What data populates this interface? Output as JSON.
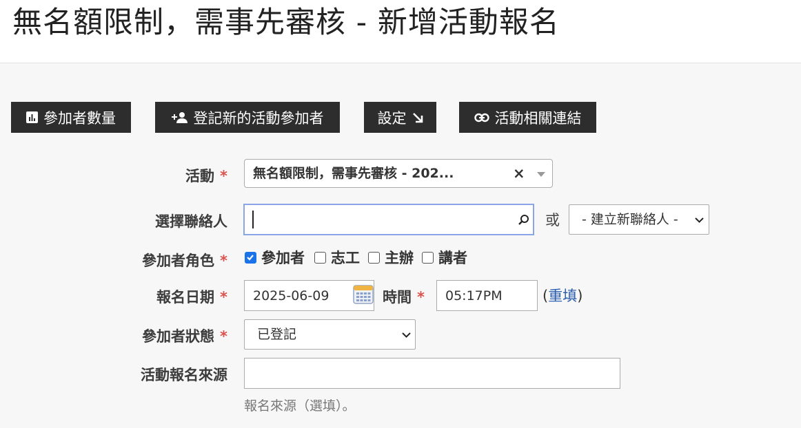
{
  "page": {
    "title": "無名額限制，需事先審核 - 新增活動報名"
  },
  "toolbar": {
    "participants_count": "參加者數量",
    "register_new": "登記新的活動參加者",
    "settings": "設定",
    "event_links": "活動相關連結"
  },
  "form": {
    "event": {
      "label": "活動",
      "value": "無名額限制，需事先審核 - 202..."
    },
    "contact": {
      "label": "選擇聯絡人",
      "value": "",
      "or": "或",
      "new_contact": "- 建立新聯絡人 -"
    },
    "role": {
      "label": "參加者角色",
      "options": [
        {
          "label": "參加者",
          "checked": true
        },
        {
          "label": "志工",
          "checked": false
        },
        {
          "label": "主辦",
          "checked": false
        },
        {
          "label": "講者",
          "checked": false
        }
      ]
    },
    "date": {
      "label": "報名日期",
      "value": "2025-06-09",
      "time_label": "時間",
      "time_value": "05:17PM",
      "reset_open": "(",
      "reset": "重填",
      "reset_close": ")"
    },
    "status": {
      "label": "參加者狀態",
      "value": "已登記"
    },
    "source": {
      "label": "活動報名來源",
      "value": "",
      "help": "報名來源（選填）。"
    }
  },
  "colors": {
    "button_bg": "#2d2d2d",
    "required": "#d9534f",
    "link": "#2a5db0",
    "checkbox_on": "#1a73e8",
    "focus": "#8aa4e8"
  }
}
